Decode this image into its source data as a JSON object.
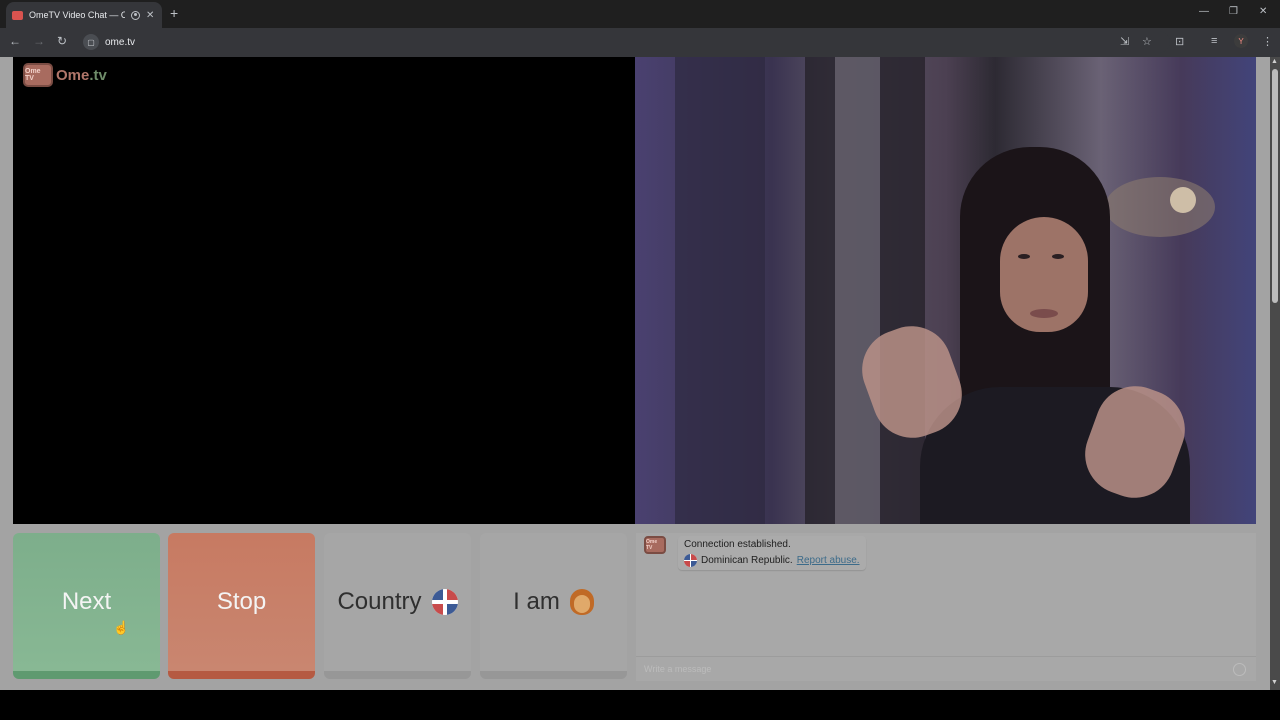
{
  "browser": {
    "tab_title": "OmeTV Video Chat — Ome",
    "tab_close": "✕",
    "new_tab": "+",
    "url": "ome.tv",
    "window_controls": [
      "—",
      "❐",
      "✕"
    ],
    "profile_initial": "Y"
  },
  "logo": {
    "icon_text": "Ome TV",
    "text_main": "Ome",
    "text_tail": ".tv"
  },
  "controls": {
    "next_label": "Next",
    "stop_label": "Stop",
    "country_label": "Country",
    "iam_label": "I am"
  },
  "chat": {
    "logo_text": "Ome TV",
    "status": "Connection established.",
    "country": "Dominican Republic.",
    "report_link": "Report abuse.",
    "input_placeholder": "Write a message"
  },
  "colors": {
    "next_button": "#7dae8b",
    "stop_button": "#c77a62",
    "report_link": "#3c6b8a"
  }
}
